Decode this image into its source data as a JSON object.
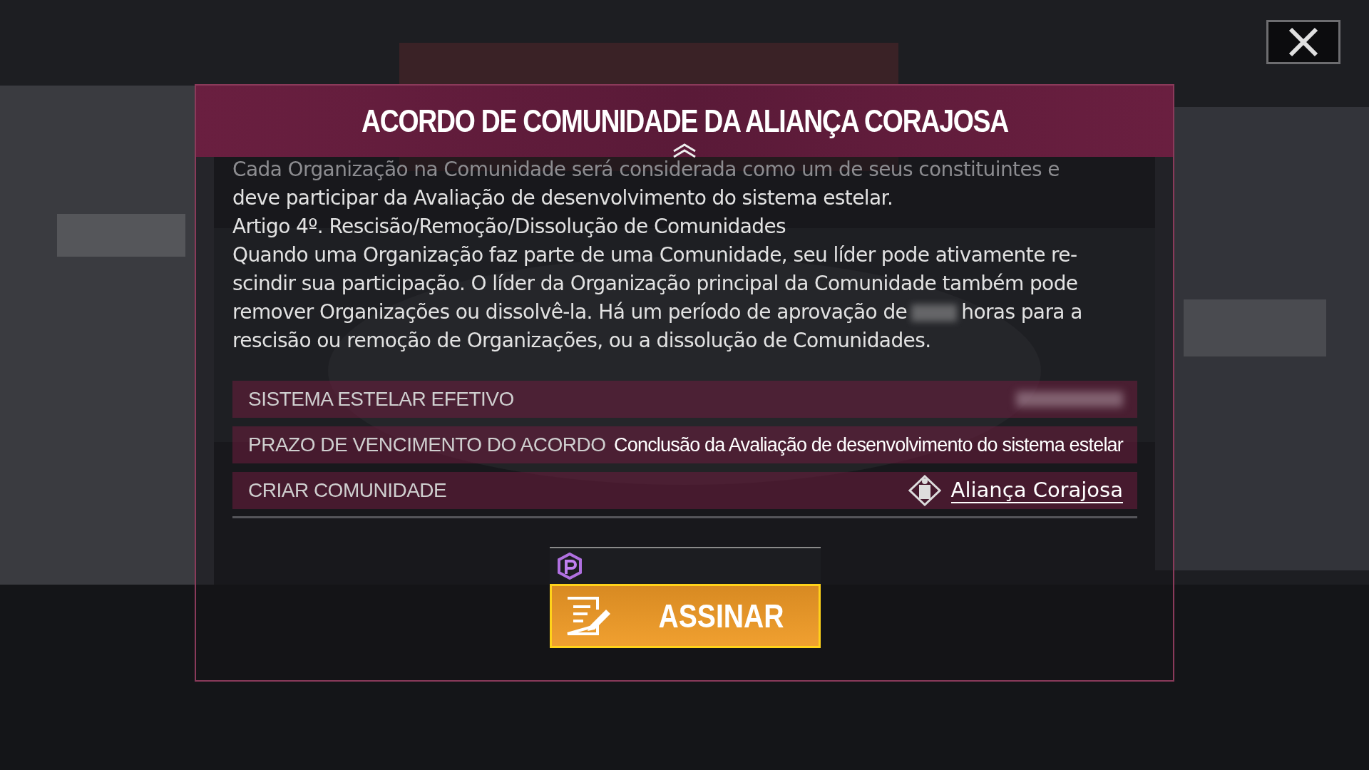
{
  "dialog": {
    "title": "ACORDO DE COMUNIDADE DA ALIANÇA CORAJOSA"
  },
  "paragraphs": [
    {
      "text": "Cada Organização na Comunidade será considerada como um de seus constituintes e",
      "faded": true
    },
    {
      "text": "deve participar da Avaliação de desenvolvimento do sistema estelar.",
      "faded": false
    },
    {
      "text": "Artigo 4º. Rescisão/Remoção/Dissolução de Comunidades",
      "faded": false
    },
    {
      "text": "Quando uma Organização faz parte de uma Comunidade, seu líder pode ativamente re-scindir sua participação. O líder da Organização principal da Comunidade também pode remover Organizações ou dissolvê-la. Há um período de aprovação de",
      "faded": false,
      "blur_after": true,
      "tail": "horas para a rescisão ou remoção de Organizações, ou a dissolução de Comunidades."
    }
  ],
  "details": [
    {
      "kind": "blurred",
      "label": "SISTEMA ESTELAR EFETIVO"
    },
    {
      "kind": "text",
      "label": "PRAZO DE VENCIMENTO DO ACORDO",
      "value": "Conclusão da Avaliação de desenvolvimento do sistema estelar"
    },
    {
      "kind": "link",
      "label": "CRIAR COMUNIDADE",
      "value": "Aliança Corajosa"
    }
  ],
  "sign_button": {
    "label": "ASSINAR"
  }
}
